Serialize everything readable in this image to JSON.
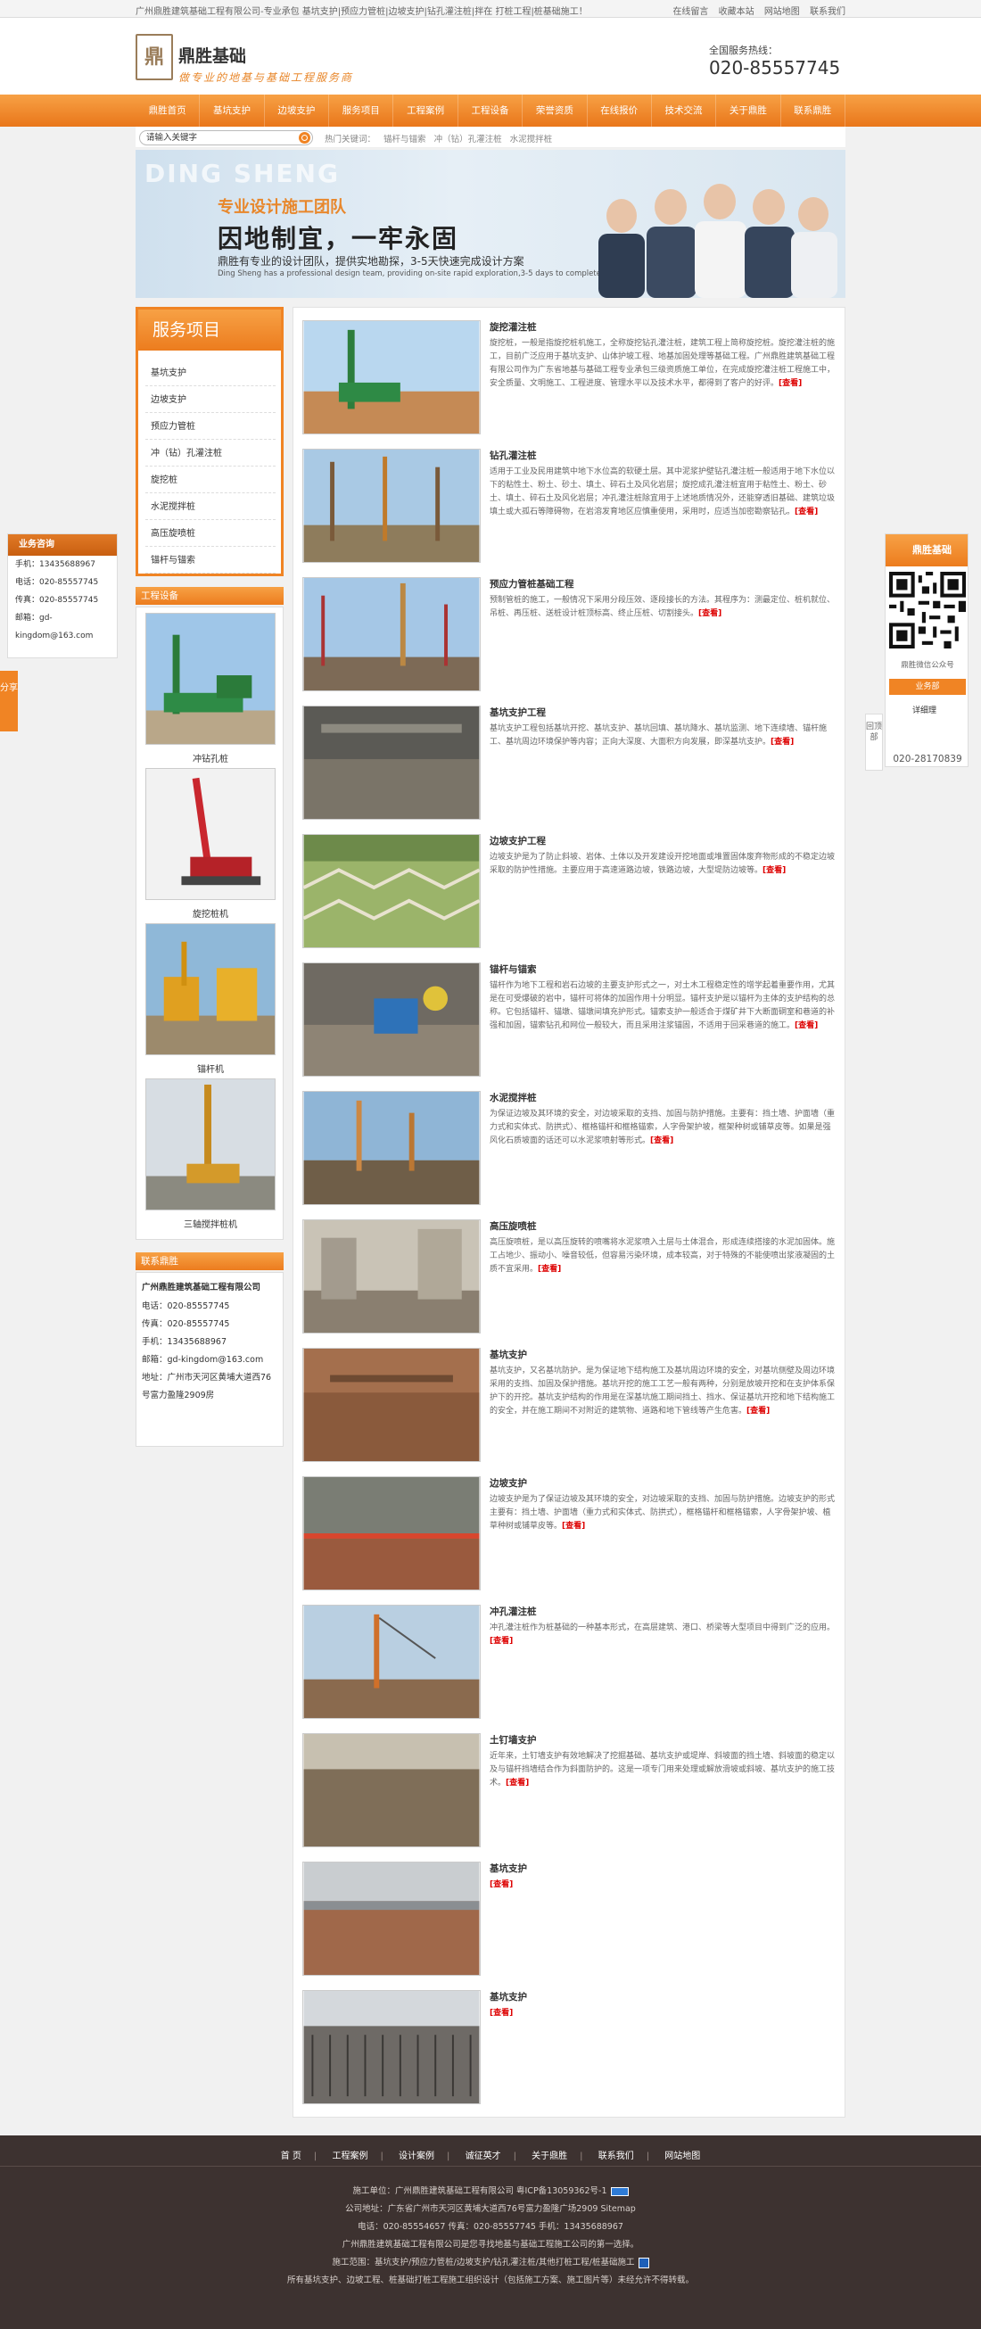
{
  "topbar": {
    "left": "广州鼎胜建筑基础工程有限公司-专业承包 基坑支护|预应力管桩|边坡支护|钻孔灌注桩|拌在 打桩工程|桩基础施工！",
    "links": [
      "在线留言",
      "收藏本站",
      "网站地图",
      "联系我们"
    ]
  },
  "header": {
    "logo_char": "鼎",
    "name": "鼎胜基础",
    "slogan": "做专业的地基与基础工程服务商",
    "hotline_label": "全国服务热线：",
    "hotline": "020-85557745"
  },
  "nav": [
    "鼎胜首页",
    "基坑支护",
    "边坡支护",
    "服务项目",
    "工程案例",
    "工程设备",
    "荣誉资质",
    "在线报价",
    "技术交流",
    "关于鼎胜",
    "联系鼎胜"
  ],
  "search": {
    "value": "请输入关键字",
    "hot_label": "热门关键词：",
    "hot": [
      "锚杆与锚索",
      "冲（钻）孔灌注桩",
      "水泥搅拌桩"
    ]
  },
  "banner": {
    "en_bg": "DING SHENG",
    "sub": "专业设计施工团队",
    "big": "因地制宜，一牢永固",
    "line3": "鼎胜有专业的设计团队，提供实地勘探，3-5天快速完成设计方案",
    "line4": "Ding Sheng has a professional design team, providing on-site rapid exploration,3-5 days to complete design"
  },
  "services": {
    "title": "服务项目",
    "items": [
      "基坑支护",
      "边坡支护",
      "预应力管桩",
      "冲（钻）孔灌注桩",
      "旋挖桩",
      "水泥搅拌桩",
      "高压旋喷桩",
      "锚杆与锚索"
    ]
  },
  "equipment": {
    "title": "工程设备",
    "items": [
      "冲钻孔桩",
      "旋挖桩机",
      "锚杆机",
      "三轴搅拌桩机"
    ]
  },
  "contact": {
    "title": "联系鼎胜",
    "company": "广州鼎胜建筑基础工程有限公司",
    "lines": [
      "电话：020-85557745",
      "传真：020-85557745",
      "手机：13435688967",
      "邮箱：gd-kingdom@163.com",
      "地址：广州市天河区黄埔大道西76号富力盈隆2909房"
    ]
  },
  "articles": [
    {
      "title": "旋挖灌注桩",
      "desc": "旋挖桩，一般是指旋挖桩机施工，全称旋挖钻孔灌注桩，建筑工程上简称旋挖桩。旋挖灌注桩的施工，目前广泛应用于基坑支护、山体护坡工程、地基加固处理等基础工程。广州鼎胜建筑基础工程有限公司作为广东省地基与基础工程专业承包三级资质施工单位，在完成旋挖灌注桩工程施工中，安全质量、文明施工、工程进度、管理水平以及技术水平，都得到了客户的好评。",
      "more": "[查看]"
    },
    {
      "title": "钻孔灌注桩",
      "desc": "适用于工业及民用建筑中地下水位高的软硬土层。其中泥浆护壁钻孔灌注桩一般适用于地下水位以下的粘性土、粉土、砂土、填土、碎石土及风化岩层；旋挖成孔灌注桩宜用于粘性土、粉土、砂土、填土、碎石土及风化岩层；冲孔灌注桩除宜用于上述地质情况外，还能穿透旧基础、建筑垃圾填土或大孤石等障碍物，在岩溶发育地区应慎重使用，采用时，应适当加密勘察钻孔。",
      "more": "[查看]"
    },
    {
      "title": "预应力管桩基础工程",
      "desc": "预制管桩的施工，一般情况下采用分段压效、逐段接长的方法。其程序为：测最定位、桩机就位、吊桩、再压桩、送桩设计桩顶标高、终止压桩、切割接头。",
      "more": "[查看]"
    },
    {
      "title": "基坑支护工程",
      "desc": "基坑支护工程包括基坑开挖、基坑支护、基坑回填、基坑降水、基坑监测、地下连续墙、锚杆施工、基坑周边环境保护等内容；正向大深度、大面积方向发展，即深基坑支护。",
      "more": "[查看]"
    },
    {
      "title": "边坡支护工程",
      "desc": "边坡支护是为了防止斜坡、岩体、土体以及开发建设开挖地面或堆置固体废弃物形成的不稳定边坡采取的防护性措施。主要应用于高速道路边坡，铁路边坡，大型堤防边坡等。",
      "more": "[查看]"
    },
    {
      "title": "锚杆与锚索",
      "desc": "锚杆作为地下工程和岩石边坡的主要支护形式之一，对土木工程稳定性的增学起着重要作用，尤其是在可受爆破的岩中，锚杆可将体的加固作用十分明显。锚杆支护是以锚杆为主体的支护结构的总称。它包括锚杆、锚墩、锚墩间填充护形式。锚索支护一般适合于煤矿井下大断面硐室和巷道的补强和加固，锚索钻孔和网位一般较大，而且采用注浆锚固，不适用于回采巷道的施工。",
      "more": "[查看]"
    },
    {
      "title": "水泥搅拌桩",
      "desc": "为保证边坡及其环境的安全，对边坡采取的支挡、加固与防护措施。主要有：挡土墙、护面墙（重力式和实体式、防拱式）、框格锚杆和框格锚索，人字骨架护坡，框架种树或铺草皮等。如果是强风化石质坡面的话还可以水泥浆喷射等形式。",
      "more": "[查看]"
    },
    {
      "title": "高压旋喷桩",
      "desc": "高压旋喷桩，是以高压旋转的喷嘴将水泥浆喷入土层与土体混合，形成连续搭接的水泥加固体。施工占地少、振动小、噪音较低，但容易污染环境，成本较高，对于特殊的不能使喷出浆液凝固的土质不宜采用。",
      "more": "[查看]"
    },
    {
      "title": "基坑支护",
      "desc": "基坑支护，又名基坑防护。是为保证地下结构施工及基坑周边环境的安全，对基坑侧壁及周边环境采用的支挡、加固及保护措施。基坑开挖的施工工艺一般有两种，分别是放坡开挖和在支护体系保护下的开挖。基坑支护结构的作用是在深基坑施工期间挡土、挡水、保证基坑开挖和地下结构施工的安全，并在施工期间不对附近的建筑物、道路和地下管线等产生危害。",
      "more": "[查看]"
    },
    {
      "title": "边坡支护",
      "desc": "边坡支护是为了保证边坡及其环境的安全，对边坡采取的支挡、加固与防护措施。边坡支护的形式主要有：挡土墙、护面墙（重力式和实体式、防拱式），框格锚杆和框格锚索，人字骨架护坡、植草种树或铺草皮等。",
      "more": "[查看]"
    },
    {
      "title": "冲孔灌注桩",
      "desc": "冲孔灌注桩作为桩基础的一种基本形式，在高层建筑、港口、桥梁等大型项目中得到广泛的应用。",
      "more": "[查看]"
    },
    {
      "title": "土钉墙支护",
      "desc": "近年来，土钉墙支护有效地解决了挖掘基础、基坑支护或堤岸、斜坡面的挡土墙、斜坡面的稳定以及与锚杆挡墙结合作为斜面防护的。这是一项专门用来处理或解放滑坡或斜坡、基坑支护的施工技术。",
      "more": "[查看]"
    },
    {
      "title": "基坑支护",
      "desc": "",
      "more": "[查看]"
    },
    {
      "title": "基坑支护",
      "desc": "",
      "more": "[查看]"
    }
  ],
  "float_left": {
    "title": "业务咨询",
    "lines": [
      "手机：13435688967",
      "电话：020-85557745",
      "传真：020-85557745",
      "邮箱：gd-kingdom@163.com"
    ]
  },
  "share": "分享",
  "float_right": {
    "title": "鼎胜基础",
    "qr_caption": "鼎胜微信公众号",
    "dept": "业务部",
    "qq": "详细理",
    "tel": "020-28170839"
  },
  "backtop": "回顶部",
  "footer": {
    "nav": [
      "首 页",
      "工程案例",
      "设计案例",
      "诚征英才",
      "关于鼎胜",
      "联系我们",
      "网站地图"
    ],
    "lines": [
      "施工单位：广州鼎胜建筑基础工程有限公司 粤ICP备13059362号-1",
      "公司地址：广东省广州市天河区黄埔大道西76号富力盈隆广场2909 Sitemap",
      "电话：020-85554657 传真：020-85557745 手机：13435688967",
      "广州鼎胜建筑基础工程有限公司是您寻找地基与基础工程施工公司的第一选择。",
      "施工范围：基坑支护/预应力管桩/边坡支护/钻孔灌注桩/其他打桩工程/桩基础施工",
      "所有基坑支护、边坡工程、桩基础打桩工程施工组织设计（包括施工方案、施工图片等）未经允许不得转载。"
    ]
  },
  "colors": {
    "accent": "#f08424",
    "footer_bg": "#3d3230",
    "more": "#dd0000"
  }
}
